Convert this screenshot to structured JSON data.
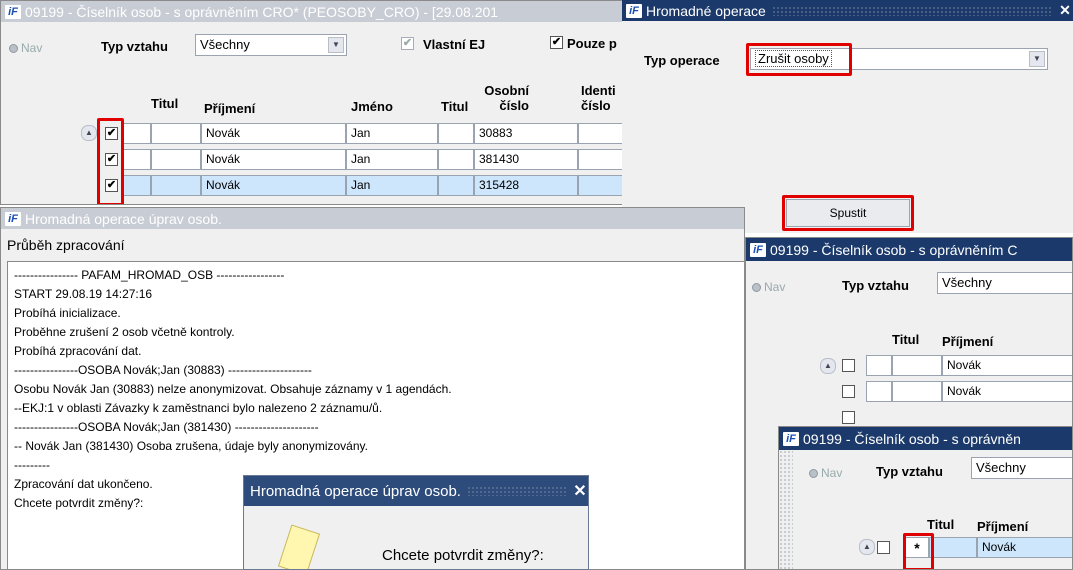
{
  "colors": {
    "titlebar_active": "#1b3a6b",
    "highlight": "#e00000",
    "row_selected": "#cde6fb"
  },
  "win_main": {
    "title": "09199 - Číselník osob - s oprávněním CRO* (PEOSOBY_CRO) - [29.08.201",
    "logo": "iF",
    "nav": "Nav",
    "typ_vztahu_label": "Typ vztahu",
    "typ_vztahu_value": "Všechny",
    "vlastni_ej_label": "Vlastní EJ",
    "pouze_label": "Pouze p",
    "headers": {
      "titul1": "Titul",
      "prijmeni": "Příjmení",
      "jmeno": "Jméno",
      "titul2": "Titul",
      "osobni_cislo": "Osobní\nčíslo",
      "ident": "Identi\nčíslo"
    },
    "rows": [
      {
        "check": "✔",
        "prijmeni": "Novák",
        "jmeno": "Jan",
        "osobni": "30883"
      },
      {
        "check": "✔",
        "prijmeni": "Novák",
        "jmeno": "Jan",
        "osobni": "381430"
      },
      {
        "check": "✔",
        "prijmeni": "Novák",
        "jmeno": "Jan",
        "osobni": "315428"
      }
    ]
  },
  "win_bulk": {
    "title": "Hromadné operace",
    "logo": "iF",
    "close": "✕",
    "typ_operace_label": "Typ operace",
    "typ_operace_value": "Zrušit osoby",
    "run_button": "Spustit"
  },
  "win_progress": {
    "title": "Hromadná operace úprav osob.",
    "logo": "iF",
    "section_label": "Průběh zpracování",
    "log": [
      "---------------- PAFAM_HROMAD_OSB -----------------",
      "START 29.08.19 14:27:16",
      "Probíhá inicializace.",
      "Proběhne zrušení 2 osob včetně kontroly.",
      "Probíhá zpracování dat.",
      "----------------OSOBA Novák;Jan (30883) ---------------------",
      "Osobu Novák Jan (30883) nelze anonymizovat. Obsahuje záznamy v 1 agendách.",
      "--EKJ:1 v oblasti Závazky k zaměstnanci bylo nalezeno 2 záznamu/ů.",
      "----------------OSOBA Novák;Jan (381430) ---------------------",
      "-- Novák Jan (381430) Osoba zrušena, údaje byly anonymizovány.",
      "---------",
      "Zpracování dat ukončeno.",
      "Chcete potvrdit změny?:"
    ]
  },
  "dialog": {
    "title": "Hromadná operace úprav osob.",
    "close": "✕",
    "message": "Chcete potvrdit změny?:"
  },
  "win_right1": {
    "title": "09199 - Číselník osob - s oprávněním C",
    "logo": "iF",
    "nav": "Nav",
    "typ_vztahu_label": "Typ vztahu",
    "typ_vztahu_value": "Všechny",
    "titul": "Titul",
    "prijmeni": "Příjmení",
    "rows": [
      "Novák",
      "Novák"
    ]
  },
  "win_right2": {
    "title": "09199 - Číselník osob - s oprávněn",
    "logo": "iF",
    "nav": "Nav",
    "typ_vztahu_label": "Typ vztahu",
    "typ_vztahu_value": "Všechny",
    "titul": "Titul",
    "prijmeni": "Příjmení",
    "star": "*",
    "row": "Novák"
  }
}
